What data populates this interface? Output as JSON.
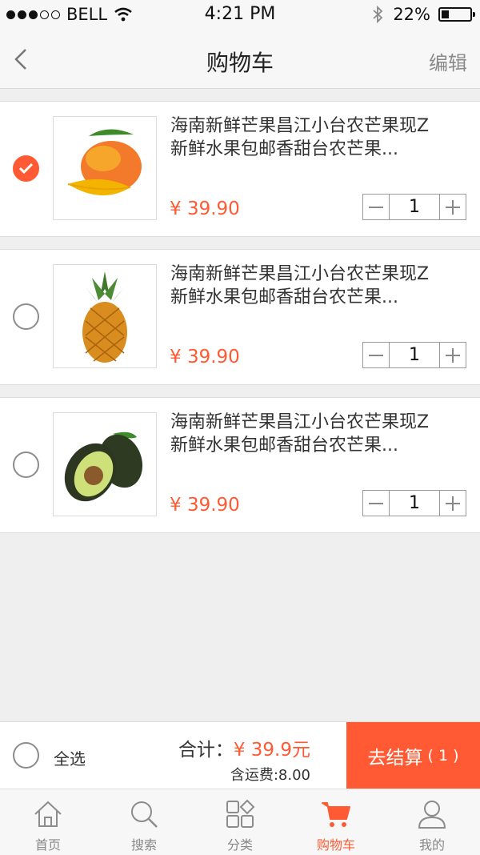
{
  "status_bar": {
    "carrier": "BELL",
    "time": "4:21 PM",
    "battery": "22%"
  },
  "nav": {
    "title": "购物车",
    "edit": "编辑"
  },
  "items": [
    {
      "name_line1": "海南新鲜芒果昌江小台农芒果现Z",
      "name_line2": "新鲜水果包邮香甜台农芒果...",
      "price": "¥ 39.90",
      "qty": "1",
      "checked": true,
      "image": "mango"
    },
    {
      "name_line1": "海南新鲜芒果昌江小台农芒果现Z",
      "name_line2": "新鲜水果包邮香甜台农芒果...",
      "price": "¥ 39.90",
      "qty": "1",
      "checked": false,
      "image": "pineapple"
    },
    {
      "name_line1": "海南新鲜芒果昌江小台农芒果现Z",
      "name_line2": "新鲜水果包邮香甜台农芒果...",
      "price": "¥ 39.90",
      "qty": "1",
      "checked": false,
      "image": "avocado"
    }
  ],
  "checkout": {
    "select_all": "全选",
    "total_label": "合计：",
    "total_amount": "¥ 39.9元",
    "shipping": "含运费:8.00",
    "button_label": "去结算",
    "button_count": "( 1 )"
  },
  "tabs": [
    {
      "label": "首页",
      "icon": "home-icon"
    },
    {
      "label": "搜索",
      "icon": "search-icon"
    },
    {
      "label": "分类",
      "icon": "category-icon"
    },
    {
      "label": "购物车",
      "icon": "cart-icon",
      "active": true
    },
    {
      "label": "我的",
      "icon": "user-icon"
    }
  ],
  "colors": {
    "accent": "#ff5a33",
    "background": "#efefef",
    "bar": "#f7f7f7"
  }
}
